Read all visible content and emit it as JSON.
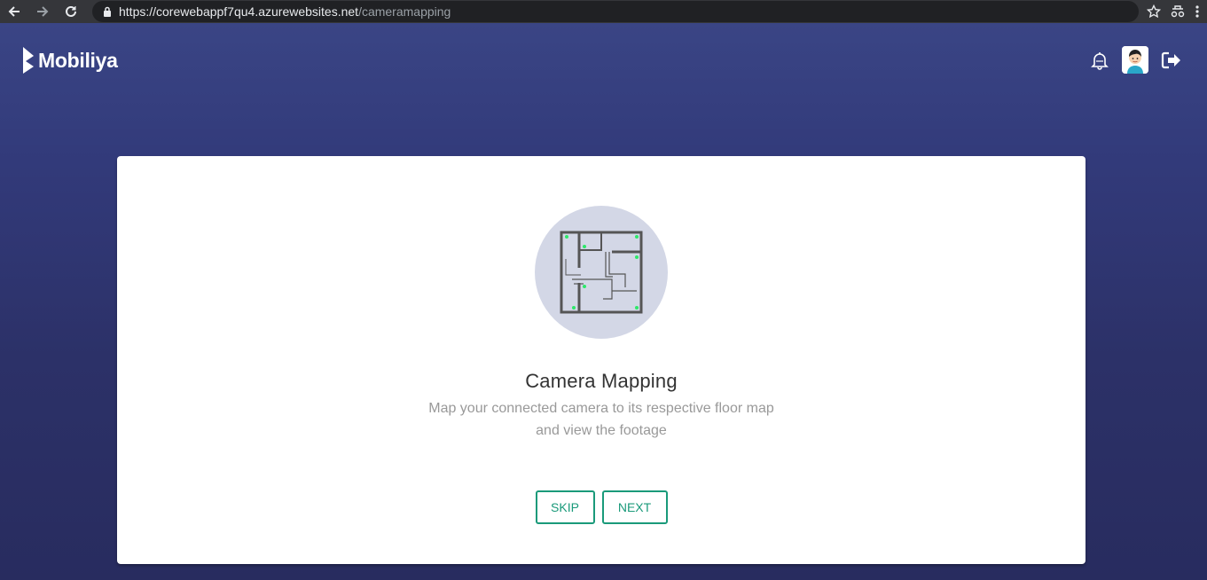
{
  "browser": {
    "url_host": "https://corewebappf7qu4.azurewebsites.net",
    "url_path": "/cameramapping",
    "icons": [
      "back-arrow-icon",
      "forward-arrow-icon",
      "reload-icon",
      "lock-icon",
      "star-icon",
      "extension-icon",
      "menu-dots-icon"
    ]
  },
  "header": {
    "logo_text": "Mobiliya",
    "icons": [
      "bell-icon",
      "avatar",
      "logout-icon"
    ]
  },
  "card": {
    "title": "Camera Mapping",
    "description_line1": "Map your connected camera to its respective floor map",
    "description_line2": "and view the footage",
    "skip_label": "SKIP",
    "next_label": "NEXT"
  },
  "colors": {
    "accent": "#1a9a7a",
    "background": "#2e3470",
    "camera_dot": "#2ee86a"
  }
}
